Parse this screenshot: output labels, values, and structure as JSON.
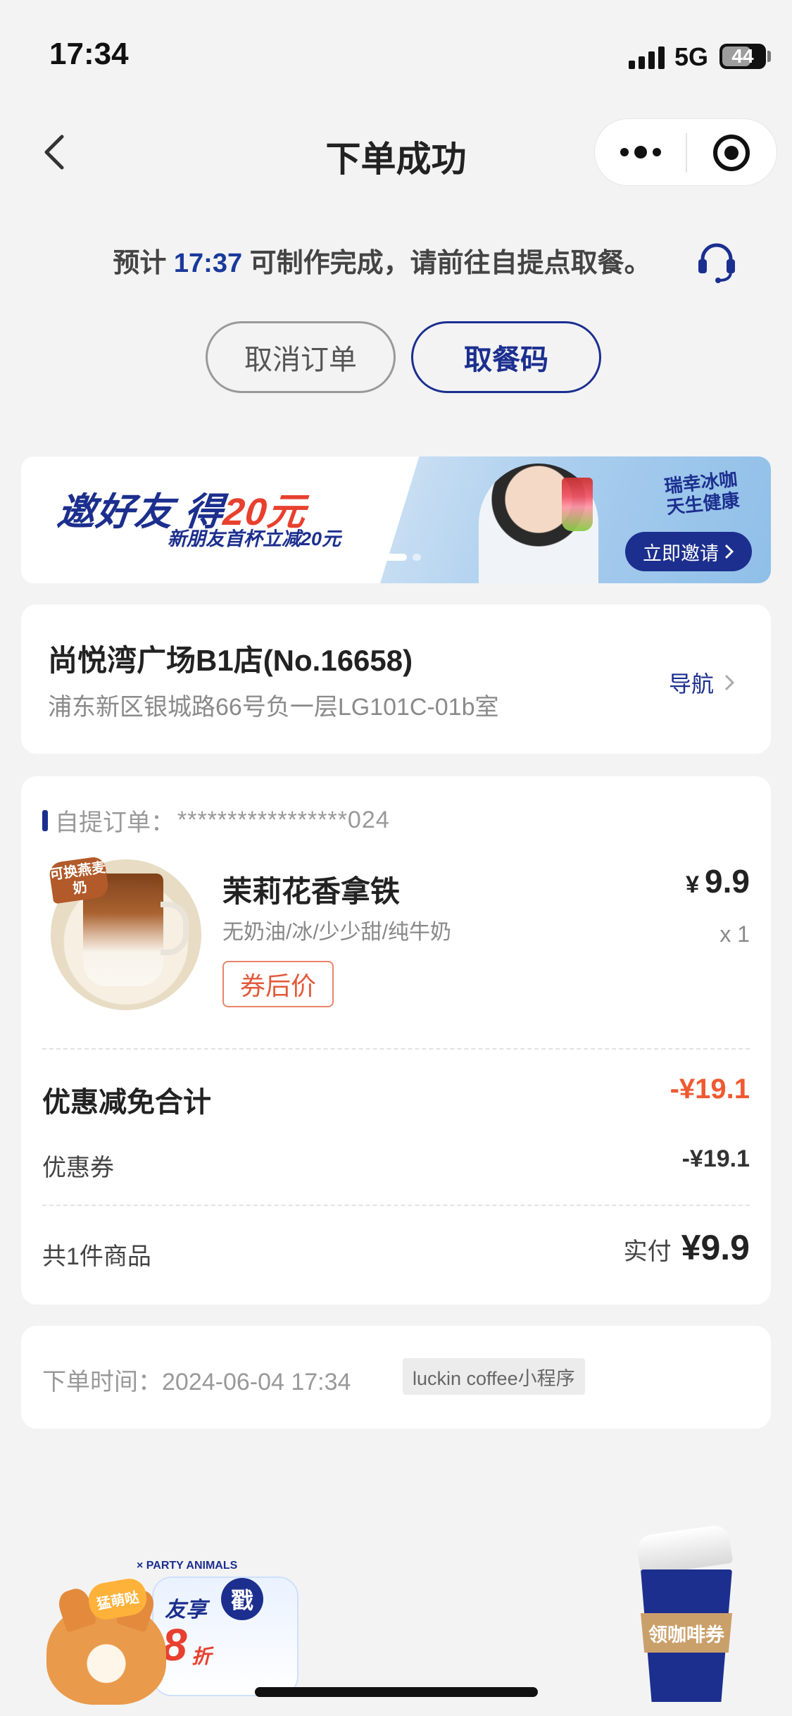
{
  "status_bar": {
    "time": "17:34",
    "network": "5G",
    "battery": "44"
  },
  "nav": {
    "title": "下单成功"
  },
  "estimate": {
    "prefix": "预计",
    "time": "17:37",
    "suffix": "可制作完成，请前往自提点取餐。"
  },
  "actions": {
    "cancel_label": "取消订单",
    "pickup_code_label": "取餐码"
  },
  "banner": {
    "headline_prefix": "邀好友 得",
    "headline_amount": "20元",
    "subline": "新朋友首杯立减20元",
    "slogan": "瑞幸冰咖 天生健康",
    "invite_label": "立即邀请"
  },
  "store": {
    "name": "尚悦湾广场B1店(No.16658)",
    "address": "浦东新区银城路66号负一层LG101C-01b室",
    "navigate_label": "导航"
  },
  "order": {
    "label": "自提订单：",
    "number_masked": "*****************024",
    "product": {
      "badge": "可换燕麦奶",
      "name": "茉莉花香拿铁",
      "spec": "无奶油/冰/少少甜/纯牛奶",
      "coupon_tag": "券后价",
      "currency": "¥",
      "price": "9.9",
      "quantity": "x 1"
    },
    "discount_title": "优惠减免合计",
    "discount_total": "-¥19.1",
    "coupon_label": "优惠券",
    "coupon_value": "-¥19.1",
    "item_count": "共1件商品",
    "paid_label": "实付",
    "paid_amount": "¥9.9"
  },
  "order_time": {
    "label": "下单时间：",
    "value": "2024-06-04 17:34",
    "source": "luckin coffee小程序"
  },
  "promos": {
    "corgi": {
      "bubble": "猛萌哒",
      "share": "友享",
      "discount": "8",
      "discount_unit": "折",
      "stamp": "戳",
      "logos": "× PARTY ANIMALS"
    },
    "coffee_coupon": {
      "label": "领咖啡券"
    }
  },
  "colors": {
    "brand_blue": "#1b2f8f",
    "discount_red": "#ef5a32",
    "background": "#f3f3f4"
  }
}
